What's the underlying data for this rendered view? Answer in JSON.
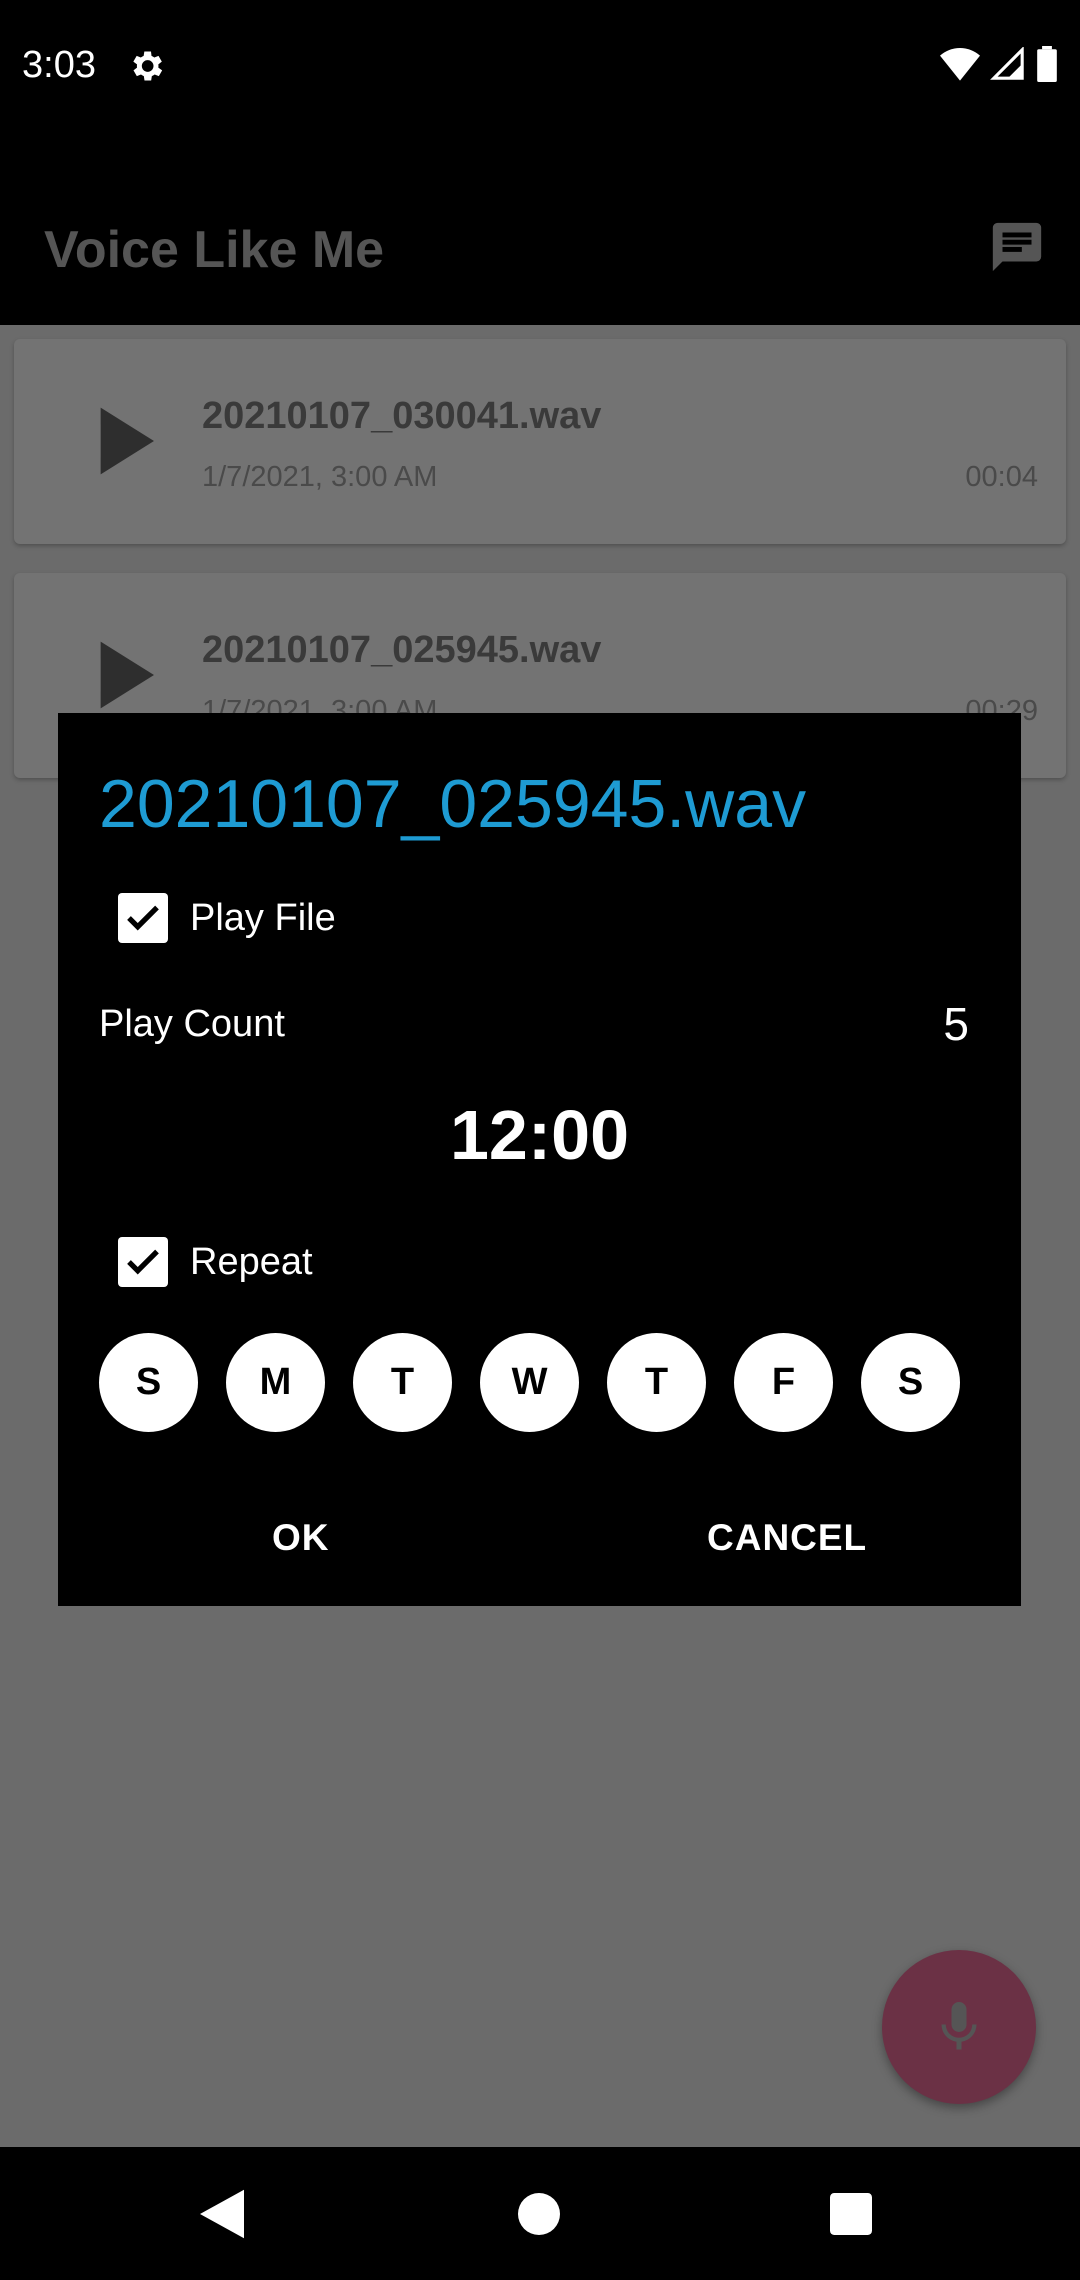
{
  "status_bar": {
    "time": "3:03"
  },
  "app_bar": {
    "title": "Voice Like Me"
  },
  "recordings": [
    {
      "name": "20210107_030041.wav",
      "date": "1/7/2021, 3:00 AM",
      "duration": "00:04"
    },
    {
      "name": "20210107_025945.wav",
      "date": "1/7/2021, 3:00 AM",
      "duration": "00:29"
    }
  ],
  "dialog": {
    "title": "20210107_025945.wav",
    "play_file": {
      "label": "Play File",
      "checked": true
    },
    "play_count": {
      "label": "Play Count",
      "value": "5"
    },
    "time": "12:00",
    "repeat": {
      "label": "Repeat",
      "checked": true
    },
    "days": [
      "S",
      "M",
      "T",
      "W",
      "T",
      "F",
      "S"
    ],
    "ok_label": "OK",
    "cancel_label": "CANCEL"
  },
  "colors": {
    "dialog_title": "#1e9bd3",
    "fab": "#6b3145",
    "scrim_background": "#6b6b6b"
  }
}
